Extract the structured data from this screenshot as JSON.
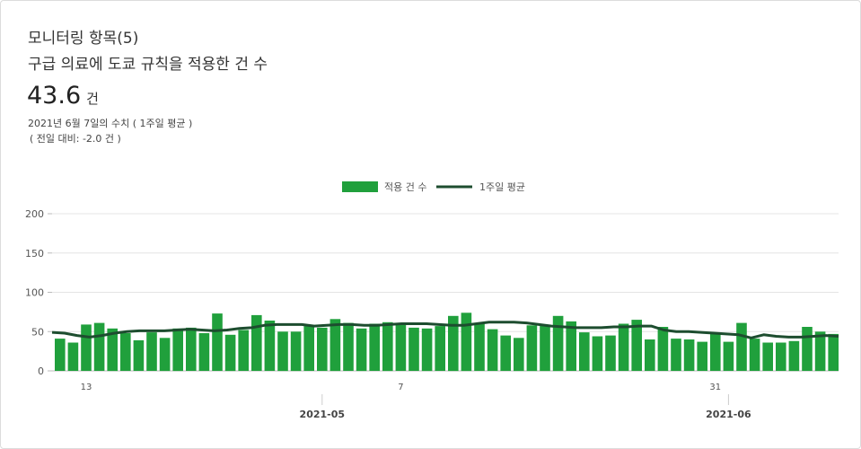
{
  "header": {
    "title": "모니터링 항목(5)",
    "subtitle": "구급 의료에 도쿄 규칙을 적용한 건 수",
    "value": "43.6",
    "unit": "건",
    "note": "2021년 6월 7일의 수치 ( 1주일 평균 )",
    "diff": "( 전일 대비: -2.0 건 )"
  },
  "chart_data": {
    "type": "bar",
    "title": "",
    "xlabel": "",
    "ylabel": "",
    "ylim": [
      0,
      200
    ],
    "yticks": [
      0,
      50,
      100,
      150,
      200
    ],
    "x": [
      "2021-04-11",
      "2021-04-12",
      "2021-04-13",
      "2021-04-14",
      "2021-04-15",
      "2021-04-16",
      "2021-04-17",
      "2021-04-18",
      "2021-04-19",
      "2021-04-20",
      "2021-04-21",
      "2021-04-22",
      "2021-04-23",
      "2021-04-24",
      "2021-04-25",
      "2021-04-26",
      "2021-04-27",
      "2021-04-28",
      "2021-04-29",
      "2021-04-30",
      "2021-05-01",
      "2021-05-02",
      "2021-05-03",
      "2021-05-04",
      "2021-05-05",
      "2021-05-06",
      "2021-05-07",
      "2021-05-08",
      "2021-05-09",
      "2021-05-10",
      "2021-05-11",
      "2021-05-12",
      "2021-05-13",
      "2021-05-14",
      "2021-05-15",
      "2021-05-16",
      "2021-05-17",
      "2021-05-18",
      "2021-05-19",
      "2021-05-20",
      "2021-05-21",
      "2021-05-22",
      "2021-05-23",
      "2021-05-24",
      "2021-05-25",
      "2021-05-26",
      "2021-05-27",
      "2021-05-28",
      "2021-05-29",
      "2021-05-30",
      "2021-05-31",
      "2021-06-01",
      "2021-06-02",
      "2021-06-03",
      "2021-06-04",
      "2021-06-05",
      "2021-06-06",
      "2021-06-07"
    ],
    "x_tick_labels": [
      "13",
      "7",
      "31"
    ],
    "x_tick_dates": [
      "2021-04-13",
      "2021-05-07",
      "2021-05-31"
    ],
    "month_labels": [
      "2021-05",
      "2021-06"
    ],
    "month_dates": [
      "2021-05-01",
      "2021-06-01"
    ],
    "legend_position": "top-center",
    "grid": true,
    "series": [
      {
        "name": "적용 건 수",
        "type": "bar",
        "color": "#20a03c",
        "values": [
          41,
          36,
          59,
          61,
          54,
          48,
          39,
          49,
          42,
          54,
          55,
          48,
          73,
          46,
          52,
          71,
          64,
          50,
          50,
          57,
          55,
          66,
          61,
          54,
          60,
          62,
          59,
          55,
          54,
          57,
          70,
          74,
          61,
          53,
          45,
          42,
          58,
          58,
          70,
          63,
          49,
          44,
          45,
          60,
          65,
          40,
          56,
          41,
          40,
          37,
          49,
          37,
          61,
          41,
          36,
          36,
          38,
          56,
          50,
          47
        ]
      },
      {
        "name": "1주일 평균",
        "type": "line",
        "color": "#1d4d2f",
        "values": [
          49,
          48,
          45,
          43,
          45,
          48,
          50,
          51,
          51,
          51,
          52,
          53,
          52,
          51,
          52,
          54,
          55,
          58,
          59,
          59,
          59,
          57,
          58,
          59,
          59,
          58,
          58,
          59,
          60,
          60,
          60,
          59,
          58,
          58,
          60,
          62,
          62,
          62,
          61,
          59,
          57,
          56,
          55,
          55,
          55,
          56,
          56,
          57,
          57,
          52,
          50,
          50,
          49,
          48,
          47,
          46,
          42,
          46,
          44,
          43,
          43,
          44,
          45,
          44
        ]
      }
    ]
  }
}
